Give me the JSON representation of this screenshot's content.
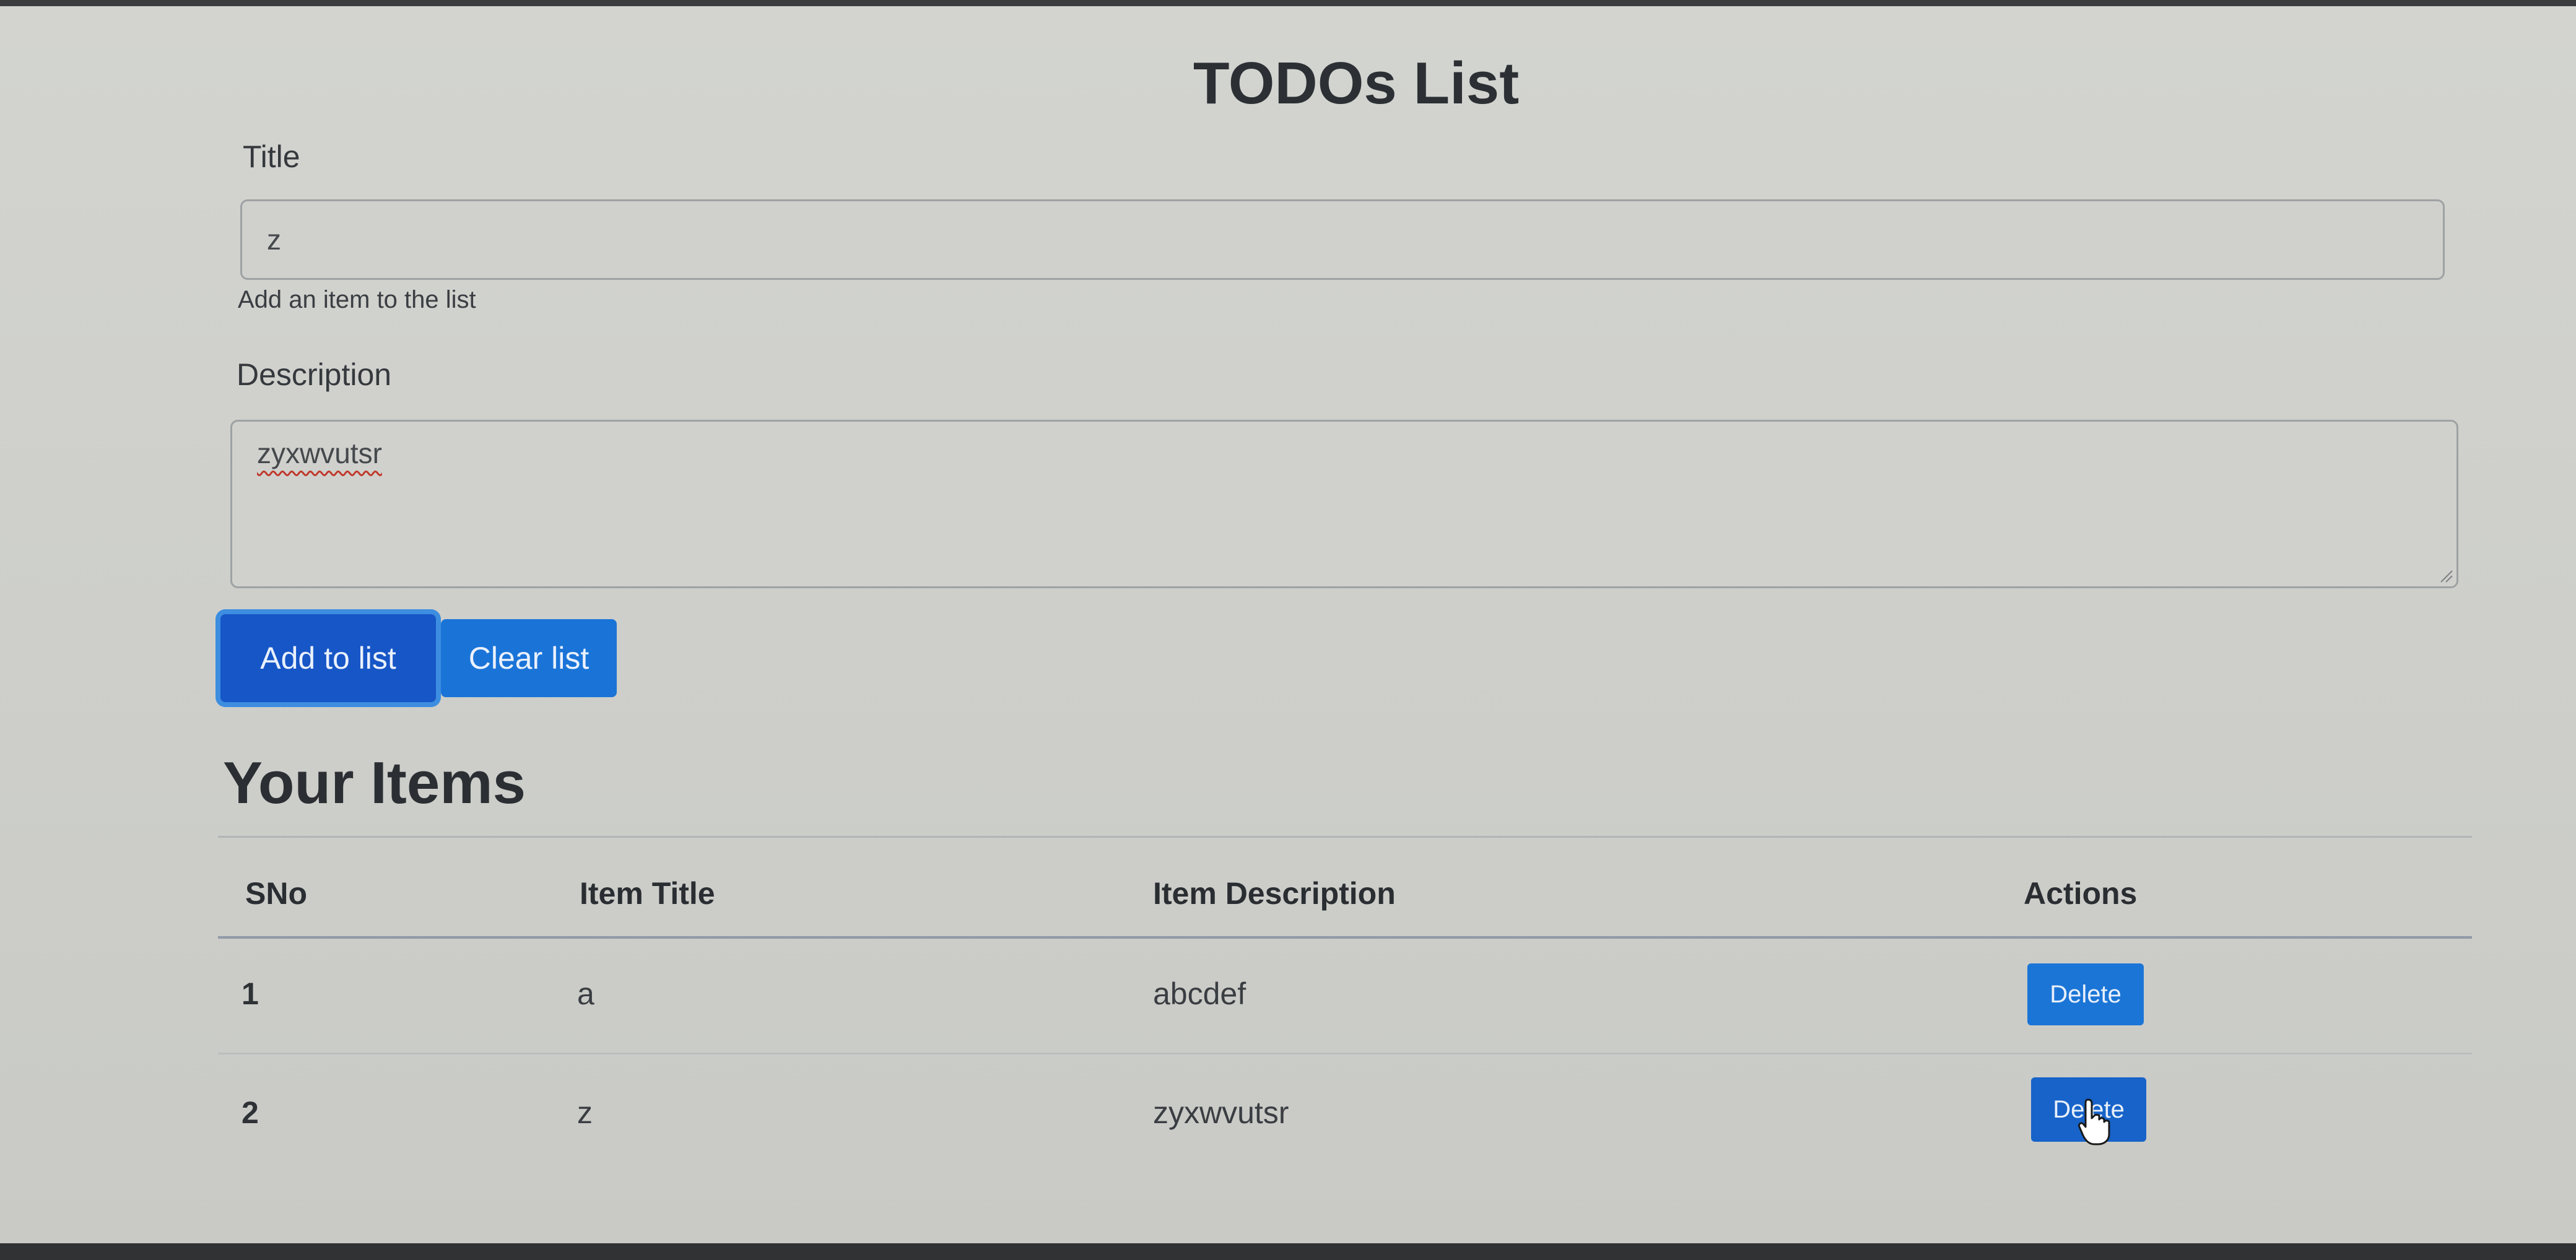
{
  "page": {
    "title": "TODOs List"
  },
  "form": {
    "title_label": "Title",
    "title_value": "z",
    "title_help": "Add an item to the list",
    "description_label": "Description",
    "description_value": "zyxwvutsr",
    "add_button": "Add to list",
    "clear_button": "Clear list"
  },
  "items": {
    "heading": "Your Items",
    "columns": [
      "SNo",
      "Item Title",
      "Item Description",
      "Actions"
    ],
    "rows": [
      {
        "sno": "1",
        "title": "a",
        "description": "abcdef",
        "action": "Delete"
      },
      {
        "sno": "2",
        "title": "z",
        "description": "zyxwvutsr",
        "action": "Delete"
      }
    ]
  },
  "colors": {
    "primary_button": "#1a74d8",
    "focused_button": "#1756c7",
    "background": "#cfd0cc"
  },
  "icons": {
    "cursor": "hand-pointer-icon",
    "resize": "resize-grip-icon"
  }
}
